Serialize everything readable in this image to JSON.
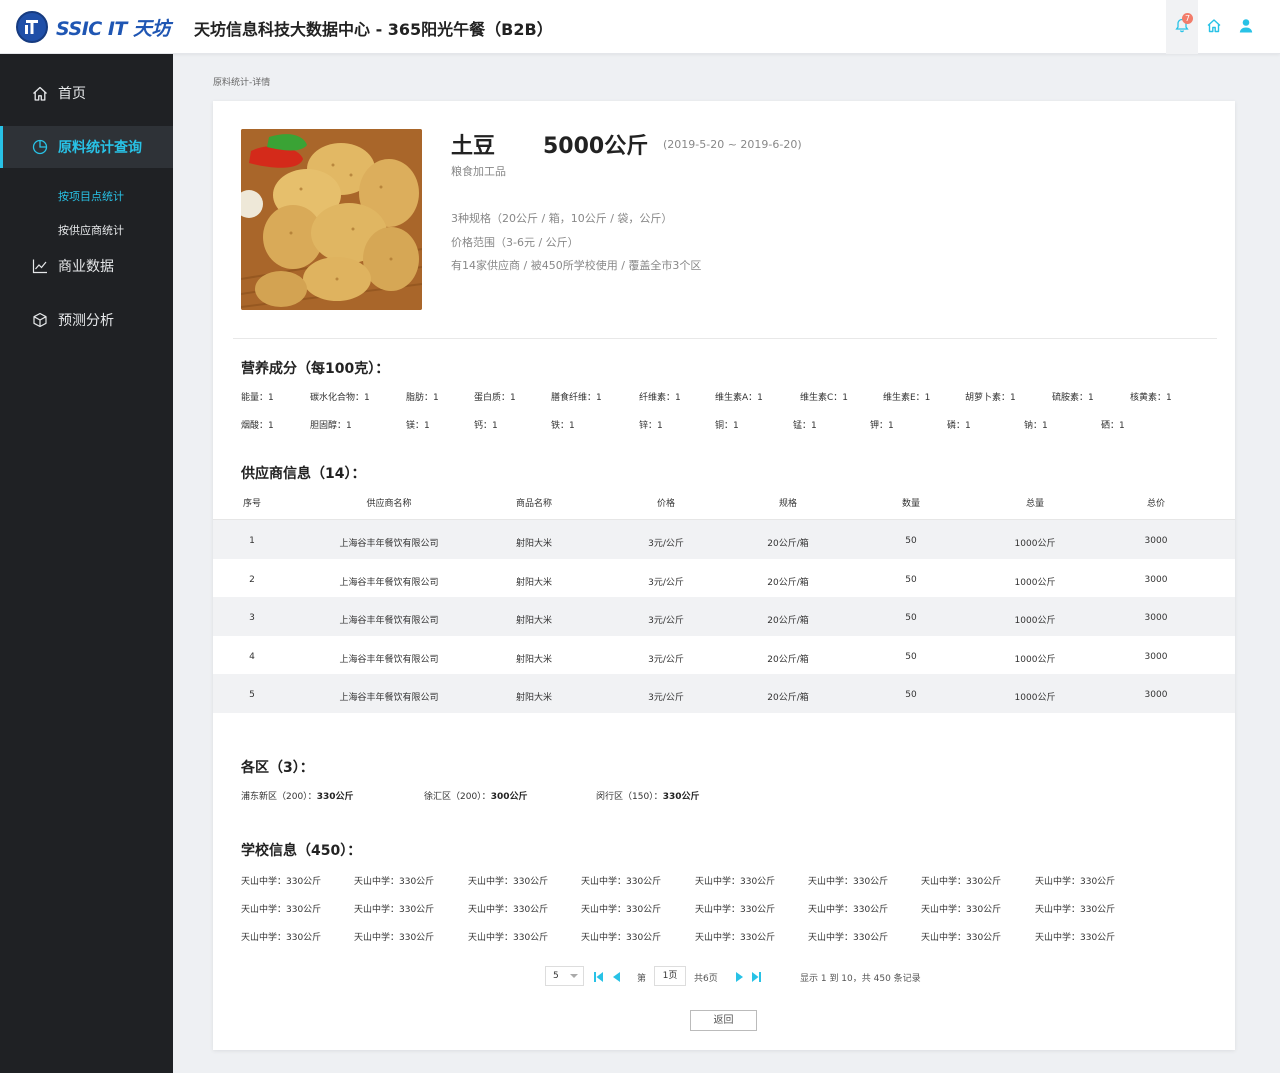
{
  "header": {
    "logo_text": "SSIC IT 天坊",
    "title": "天坊信息科技大数据中心 - 365阳光午餐（B2B）",
    "notification_count": "7"
  },
  "sidebar": {
    "items": [
      {
        "label": "首页",
        "icon": "home-icon"
      },
      {
        "label": "原料统计查询",
        "icon": "pie-chart-icon",
        "active": true
      },
      {
        "label": "商业数据",
        "icon": "line-chart-icon"
      },
      {
        "label": "预测分析",
        "icon": "cube-icon"
      }
    ],
    "subitems": [
      {
        "label": "按项目点统计",
        "active": true
      },
      {
        "label": "按供应商统计"
      }
    ]
  },
  "breadcrumb": "原料统计-详情",
  "product": {
    "name": "土豆",
    "weight": "5000公斤",
    "date_range": "(2019-5-20 ~ 2019-6-20)",
    "category": "粮食加工品",
    "specs": "3种规格（20公斤 / 箱，10公斤 / 袋，公斤）",
    "price_range": "价格范围（3-6元 / 公斤）",
    "coverage": "有14家供应商 / 被450所学校使用 / 覆盖全市3个区"
  },
  "nutrition": {
    "title": "营养成分（每100克）：",
    "row1": [
      "能量：1",
      "碳水化合物：1",
      "脂肪：1",
      "蛋白质：1",
      "膳食纤维：1",
      "纤维素：1",
      "维生素A：1",
      "维生素C：1",
      "维生素E：1",
      "胡萝卜素：1",
      "硫胺素：1",
      "核黄素：1"
    ],
    "row2": [
      "烟酸：1",
      "胆固醇：1",
      "镁：1",
      "钙：1",
      "铁：1",
      "锌：1",
      "铜：1",
      "锰：1",
      "钾：1",
      "磷：1",
      "钠：1",
      "硒：1"
    ]
  },
  "suppliers": {
    "title": "供应商信息（14）：",
    "columns": [
      "序号",
      "供应商名称",
      "商品名称",
      "价格",
      "规格",
      "数量",
      "总量",
      "总价"
    ],
    "rows": [
      [
        "1",
        "上海谷丰年餐饮有限公司",
        "射阳大米",
        "3元/公斤",
        "20公斤/箱",
        "50",
        "1000公斤",
        "3000"
      ],
      [
        "2",
        "上海谷丰年餐饮有限公司",
        "射阳大米",
        "3元/公斤",
        "20公斤/箱",
        "50",
        "1000公斤",
        "3000"
      ],
      [
        "3",
        "上海谷丰年餐饮有限公司",
        "射阳大米",
        "3元/公斤",
        "20公斤/箱",
        "50",
        "1000公斤",
        "3000"
      ],
      [
        "4",
        "上海谷丰年餐饮有限公司",
        "射阳大米",
        "3元/公斤",
        "20公斤/箱",
        "50",
        "1000公斤",
        "3000"
      ],
      [
        "5",
        "上海谷丰年餐饮有限公司",
        "射阳大米",
        "3元/公斤",
        "20公斤/箱",
        "50",
        "1000公斤",
        "3000"
      ]
    ]
  },
  "regions": {
    "title": "各区（3）：",
    "items": [
      {
        "label": "浦东新区（200）：",
        "value": "330公斤"
      },
      {
        "label": "徐汇区（200）：",
        "value": "300公斤"
      },
      {
        "label": "闵行区（150）：",
        "value": "330公斤"
      }
    ]
  },
  "schools": {
    "title": "学校信息（450）：",
    "item": "天山中学：330公斤"
  },
  "pagination": {
    "page_size": "5",
    "page_prefix": "第",
    "current_page": "1页",
    "total_pages": "共6页",
    "summary": "显示 1 到 10，共 450 条记录"
  },
  "back_label": "返回",
  "colors": {
    "accent": "#28c2e6",
    "sidebar_bg": "#1f2124",
    "brand": "#1f56b3"
  }
}
